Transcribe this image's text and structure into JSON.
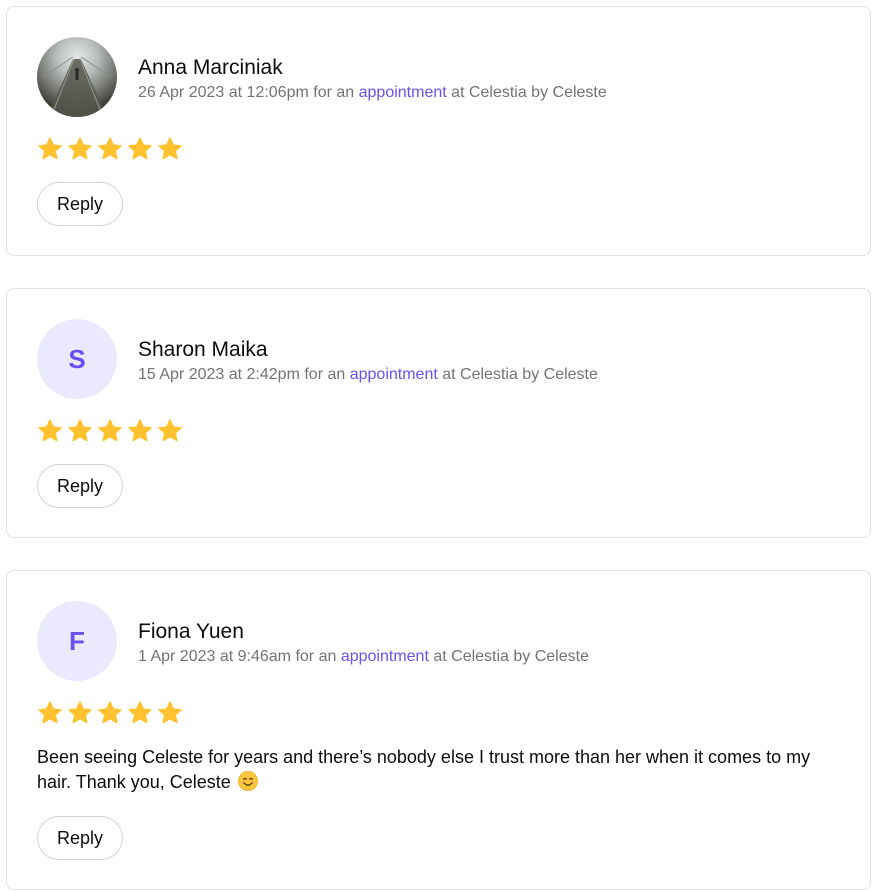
{
  "colors": {
    "accent": "#6950f3",
    "star": "#ffc12d",
    "avatar_bg": "#ebe9fd",
    "meta_text": "#737373",
    "border": "#e2e2e6"
  },
  "reviews": [
    {
      "name": "Anna Marciniak",
      "avatar": {
        "type": "photo",
        "icon": "walkway-photo"
      },
      "date": "26 Apr 2023 at 12:06pm",
      "meta_prefix": "for an",
      "link_text": "appointment",
      "meta_suffix": "at Celestia by Celeste",
      "rating": 5,
      "text": "",
      "reply_label": "Reply"
    },
    {
      "name": "Sharon Maika",
      "avatar": {
        "type": "initial",
        "initial": "S"
      },
      "date": "15 Apr 2023 at 2:42pm",
      "meta_prefix": "for an",
      "link_text": "appointment",
      "meta_suffix": "at Celestia by Celeste",
      "rating": 5,
      "text": "",
      "reply_label": "Reply"
    },
    {
      "name": "Fiona Yuen",
      "avatar": {
        "type": "initial",
        "initial": "F"
      },
      "date": "1 Apr 2023 at 9:46am",
      "meta_prefix": "for an",
      "link_text": "appointment",
      "meta_suffix": "at Celestia by Celeste",
      "rating": 5,
      "text": "Been seeing Celeste for years and there’s nobody else I trust more than her when it comes to my hair. Thank you, Celeste",
      "text_emoji": "smiling-face-emoji",
      "reply_label": "Reply"
    }
  ]
}
